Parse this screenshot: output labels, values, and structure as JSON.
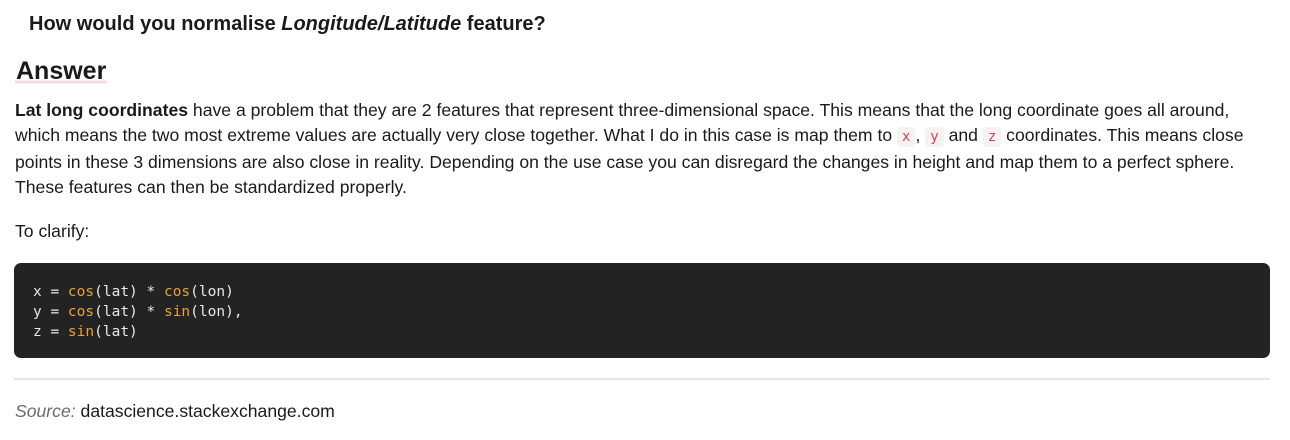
{
  "question": {
    "prefix": "How would you normalise ",
    "emphasis": "Longitude/Latitude",
    "suffix": " feature?"
  },
  "answer": {
    "heading": "Answer",
    "bold_lead": "Lat long coordinates",
    "text_1": " have a problem that they are 2 features that represent three-dimensional space. This means that the long coordinate goes all around, which means the two most extreme values are actually very close together. What I do in this case is map them to ",
    "code_x": "x",
    "sep_1": ", ",
    "code_y": "y",
    "sep_2": " and ",
    "code_z": "z",
    "text_2": " coordinates. This means close points in these 3 dimensions are also close in reality. Depending on the use case you can disregard the changes in height and map them to a perfect sphere. These features can then be standardized properly.",
    "clarify": "To clarify:"
  },
  "code": {
    "line1": {
      "a": "x = ",
      "f1": "cos",
      "b": "(lat) * ",
      "f2": "cos",
      "c": "(lon)"
    },
    "line2": {
      "a": "y = ",
      "f1": "cos",
      "b": "(lat) * ",
      "f2": "sin",
      "c": "(lon),"
    },
    "line3": {
      "a": "z = ",
      "f1": "sin",
      "b": "(lat)"
    }
  },
  "source": {
    "label": "Source:",
    "site": "datascience.stackexchange.com"
  }
}
